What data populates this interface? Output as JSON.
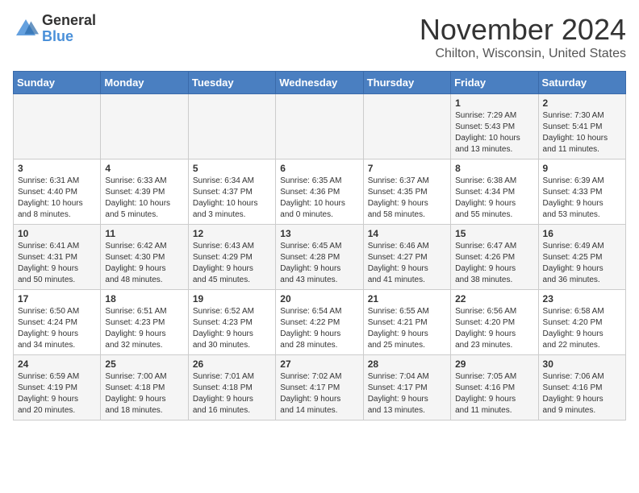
{
  "logo": {
    "general": "General",
    "blue": "Blue"
  },
  "title": "November 2024",
  "location": "Chilton, Wisconsin, United States",
  "headers": [
    "Sunday",
    "Monday",
    "Tuesday",
    "Wednesday",
    "Thursday",
    "Friday",
    "Saturday"
  ],
  "weeks": [
    [
      {
        "day": "",
        "info": ""
      },
      {
        "day": "",
        "info": ""
      },
      {
        "day": "",
        "info": ""
      },
      {
        "day": "",
        "info": ""
      },
      {
        "day": "",
        "info": ""
      },
      {
        "day": "1",
        "info": "Sunrise: 7:29 AM\nSunset: 5:43 PM\nDaylight: 10 hours\nand 13 minutes."
      },
      {
        "day": "2",
        "info": "Sunrise: 7:30 AM\nSunset: 5:41 PM\nDaylight: 10 hours\nand 11 minutes."
      }
    ],
    [
      {
        "day": "3",
        "info": "Sunrise: 6:31 AM\nSunset: 4:40 PM\nDaylight: 10 hours\nand 8 minutes."
      },
      {
        "day": "4",
        "info": "Sunrise: 6:33 AM\nSunset: 4:39 PM\nDaylight: 10 hours\nand 5 minutes."
      },
      {
        "day": "5",
        "info": "Sunrise: 6:34 AM\nSunset: 4:37 PM\nDaylight: 10 hours\nand 3 minutes."
      },
      {
        "day": "6",
        "info": "Sunrise: 6:35 AM\nSunset: 4:36 PM\nDaylight: 10 hours\nand 0 minutes."
      },
      {
        "day": "7",
        "info": "Sunrise: 6:37 AM\nSunset: 4:35 PM\nDaylight: 9 hours\nand 58 minutes."
      },
      {
        "day": "8",
        "info": "Sunrise: 6:38 AM\nSunset: 4:34 PM\nDaylight: 9 hours\nand 55 minutes."
      },
      {
        "day": "9",
        "info": "Sunrise: 6:39 AM\nSunset: 4:33 PM\nDaylight: 9 hours\nand 53 minutes."
      }
    ],
    [
      {
        "day": "10",
        "info": "Sunrise: 6:41 AM\nSunset: 4:31 PM\nDaylight: 9 hours\nand 50 minutes."
      },
      {
        "day": "11",
        "info": "Sunrise: 6:42 AM\nSunset: 4:30 PM\nDaylight: 9 hours\nand 48 minutes."
      },
      {
        "day": "12",
        "info": "Sunrise: 6:43 AM\nSunset: 4:29 PM\nDaylight: 9 hours\nand 45 minutes."
      },
      {
        "day": "13",
        "info": "Sunrise: 6:45 AM\nSunset: 4:28 PM\nDaylight: 9 hours\nand 43 minutes."
      },
      {
        "day": "14",
        "info": "Sunrise: 6:46 AM\nSunset: 4:27 PM\nDaylight: 9 hours\nand 41 minutes."
      },
      {
        "day": "15",
        "info": "Sunrise: 6:47 AM\nSunset: 4:26 PM\nDaylight: 9 hours\nand 38 minutes."
      },
      {
        "day": "16",
        "info": "Sunrise: 6:49 AM\nSunset: 4:25 PM\nDaylight: 9 hours\nand 36 minutes."
      }
    ],
    [
      {
        "day": "17",
        "info": "Sunrise: 6:50 AM\nSunset: 4:24 PM\nDaylight: 9 hours\nand 34 minutes."
      },
      {
        "day": "18",
        "info": "Sunrise: 6:51 AM\nSunset: 4:23 PM\nDaylight: 9 hours\nand 32 minutes."
      },
      {
        "day": "19",
        "info": "Sunrise: 6:52 AM\nSunset: 4:23 PM\nDaylight: 9 hours\nand 30 minutes."
      },
      {
        "day": "20",
        "info": "Sunrise: 6:54 AM\nSunset: 4:22 PM\nDaylight: 9 hours\nand 28 minutes."
      },
      {
        "day": "21",
        "info": "Sunrise: 6:55 AM\nSunset: 4:21 PM\nDaylight: 9 hours\nand 25 minutes."
      },
      {
        "day": "22",
        "info": "Sunrise: 6:56 AM\nSunset: 4:20 PM\nDaylight: 9 hours\nand 23 minutes."
      },
      {
        "day": "23",
        "info": "Sunrise: 6:58 AM\nSunset: 4:20 PM\nDaylight: 9 hours\nand 22 minutes."
      }
    ],
    [
      {
        "day": "24",
        "info": "Sunrise: 6:59 AM\nSunset: 4:19 PM\nDaylight: 9 hours\nand 20 minutes."
      },
      {
        "day": "25",
        "info": "Sunrise: 7:00 AM\nSunset: 4:18 PM\nDaylight: 9 hours\nand 18 minutes."
      },
      {
        "day": "26",
        "info": "Sunrise: 7:01 AM\nSunset: 4:18 PM\nDaylight: 9 hours\nand 16 minutes."
      },
      {
        "day": "27",
        "info": "Sunrise: 7:02 AM\nSunset: 4:17 PM\nDaylight: 9 hours\nand 14 minutes."
      },
      {
        "day": "28",
        "info": "Sunrise: 7:04 AM\nSunset: 4:17 PM\nDaylight: 9 hours\nand 13 minutes."
      },
      {
        "day": "29",
        "info": "Sunrise: 7:05 AM\nSunset: 4:16 PM\nDaylight: 9 hours\nand 11 minutes."
      },
      {
        "day": "30",
        "info": "Sunrise: 7:06 AM\nSunset: 4:16 PM\nDaylight: 9 hours\nand 9 minutes."
      }
    ]
  ]
}
